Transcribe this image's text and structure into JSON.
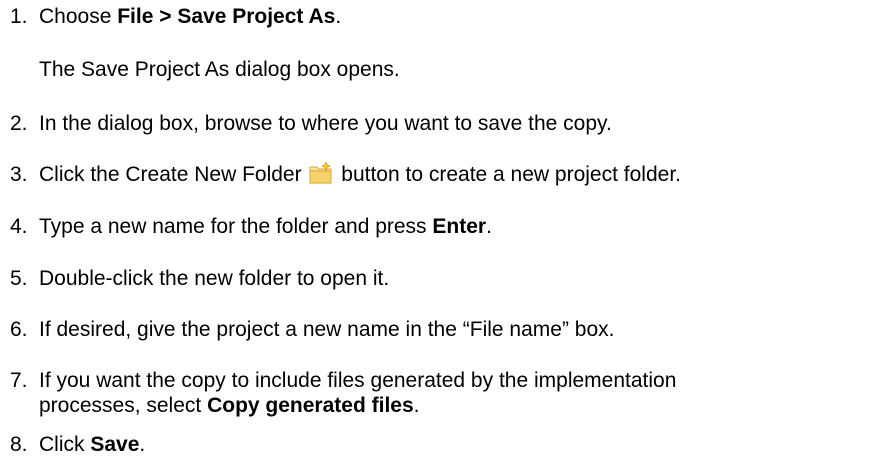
{
  "steps": [
    {
      "number": "1.",
      "text_before": "Choose ",
      "bold": "File > Save Project As",
      "text_after": ".",
      "result": "The Save Project As dialog box opens."
    },
    {
      "number": "2.",
      "text": "In the dialog box, browse to where you want to save the copy."
    },
    {
      "number": "3.",
      "text_before": "Click the Create New Folder ",
      "icon": "new-folder-icon",
      "text_after": " button to create a new project folder."
    },
    {
      "number": "4.",
      "text_before": "Type a new name for the folder and press ",
      "bold": "Enter",
      "text_after": "."
    },
    {
      "number": "5.",
      "text": "Double-click the new folder to open it."
    },
    {
      "number": "6.",
      "text": "If desired, give the project a new name in the “File name” box."
    },
    {
      "number": "7.",
      "line1": "If you want the copy to include files generated by the implementation",
      "line2_before": "processes, select ",
      "bold": "Copy generated files",
      "line2_after": "."
    },
    {
      "number": "8.",
      "text_before": "Click ",
      "bold": "Save",
      "text_after": "."
    }
  ]
}
